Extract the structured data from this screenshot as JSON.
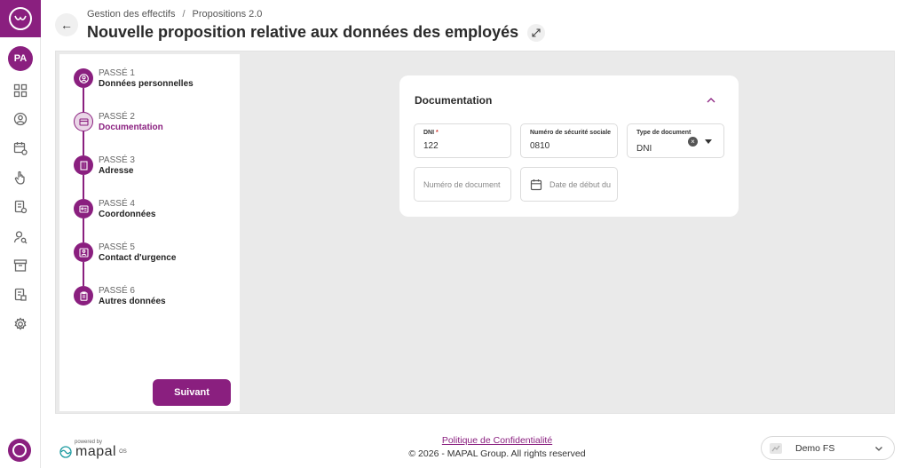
{
  "user": {
    "initials": "PA"
  },
  "breadcrumb": {
    "parent": "Gestion des effectifs",
    "separator": "/",
    "current": "Propositions 2.0"
  },
  "page": {
    "title": "Nouvelle proposition relative aux données des employés"
  },
  "steps": [
    {
      "number": "PASSÉ 1",
      "label": "Données personnelles",
      "icon": "person-icon",
      "state": "completed"
    },
    {
      "number": "PASSÉ 2",
      "label": "Documentation",
      "icon": "card-icon",
      "state": "current"
    },
    {
      "number": "PASSÉ 3",
      "label": "Adresse",
      "icon": "building-icon",
      "state": "completed"
    },
    {
      "number": "PASSÉ 4",
      "label": "Coordonnées",
      "icon": "contact-card-icon",
      "state": "completed"
    },
    {
      "number": "PASSÉ 5",
      "label": "Contact d'urgence",
      "icon": "emergency-contact-icon",
      "state": "completed"
    },
    {
      "number": "PASSÉ 6",
      "label": "Autres données",
      "icon": "clipboard-icon",
      "state": "completed"
    }
  ],
  "next_button": {
    "label": "Suivant"
  },
  "documentation": {
    "title": "Documentation",
    "dni": {
      "label": "DNI",
      "required_mark": "*",
      "value": "122"
    },
    "social_security": {
      "label": "Numéro de sécurité sociale",
      "value": "0810"
    },
    "document_type": {
      "label": "Type de document",
      "value": "DNI"
    },
    "document_number": {
      "placeholder": "Numéro de document"
    },
    "start_date": {
      "placeholder": "Date de début du"
    }
  },
  "footer": {
    "powered_by": "powered by",
    "brand": "mapal",
    "brand_suffix": "OS",
    "privacy": "Politique de Confidentialité",
    "copyright": "© 2026 - MAPAL Group. All rights reserved",
    "company": "Demo FS"
  },
  "colors": {
    "accent": "#8a1f7f",
    "background": "#eaeaea"
  }
}
